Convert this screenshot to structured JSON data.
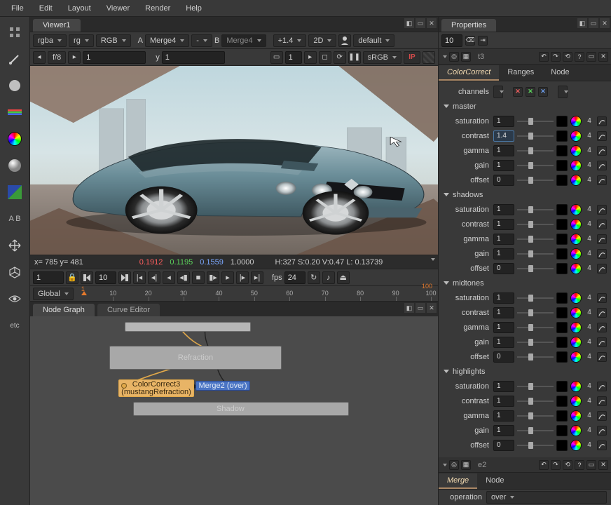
{
  "menu": {
    "items": [
      "File",
      "Edit",
      "Layout",
      "Viewer",
      "Render",
      "Help"
    ]
  },
  "viewer": {
    "tab": "Viewer1",
    "bar1": {
      "layers": "rgba",
      "layersShort": "rg",
      "colorspace": "RGB",
      "aLabel": "A",
      "aVal": "Merge4",
      "bLabel": "B",
      "bVal": "Merge4",
      "dash": "-",
      "proxy": "+1.4",
      "dim": "2D",
      "profile": "default"
    },
    "bar2": {
      "stop": "f/8",
      "stopVal": "1",
      "yLabel": "y",
      "yVal": "1",
      "monCount": "1",
      "cspace": "sRGB",
      "ip": "IP"
    },
    "status": {
      "xyLabel": "x= 785 y= 481",
      "r": "0.1912",
      "g": "0.1195",
      "b": "0.1559",
      "a": "1.0000",
      "info": "H:327 S:0.20 V:0.47 L: 0.13739"
    },
    "transport": {
      "curFrame": "1",
      "inc": "10",
      "fpsLabel": "fps",
      "fps": "24",
      "rangeStart": "1",
      "rangeEnd": "100",
      "mode": "Global"
    },
    "ticks": [
      "10",
      "20",
      "30",
      "40",
      "50",
      "60",
      "70",
      "80",
      "90",
      "100"
    ]
  },
  "graph": {
    "tabs": [
      "Node Graph",
      "Curve Editor"
    ],
    "nodes": {
      "refraction": "Refraction",
      "colorcorrect": "ColorCorrect3",
      "ccSub": "(mustangRefraction)",
      "merge": "Merge2 (over)",
      "shadow": "Shadow"
    }
  },
  "properties": {
    "title": "Properties",
    "headerCount": "10",
    "panel1": {
      "tag": "t3",
      "tabs": [
        "ColorCorrect",
        "Ranges",
        "Node"
      ],
      "channelsLabel": "channels",
      "groups": [
        "master",
        "shadows",
        "midtones",
        "highlights"
      ],
      "rowLabels": [
        "saturation",
        "contrast",
        "gamma",
        "gain",
        "offset"
      ],
      "masterVals": [
        "1",
        "1.4",
        "1",
        "1",
        "0"
      ],
      "shadowsVals": [
        "1",
        "1",
        "1",
        "1",
        "0"
      ],
      "midtonesVals": [
        "1",
        "1",
        "1",
        "1",
        "0"
      ],
      "highlightsVals": [
        "1",
        "1",
        "1",
        "1",
        "0"
      ],
      "four": "4"
    },
    "panel2": {
      "tag": "e2",
      "tabs": [
        "Merge",
        "Node"
      ],
      "opLabel": "operation",
      "opVal": "over"
    }
  }
}
